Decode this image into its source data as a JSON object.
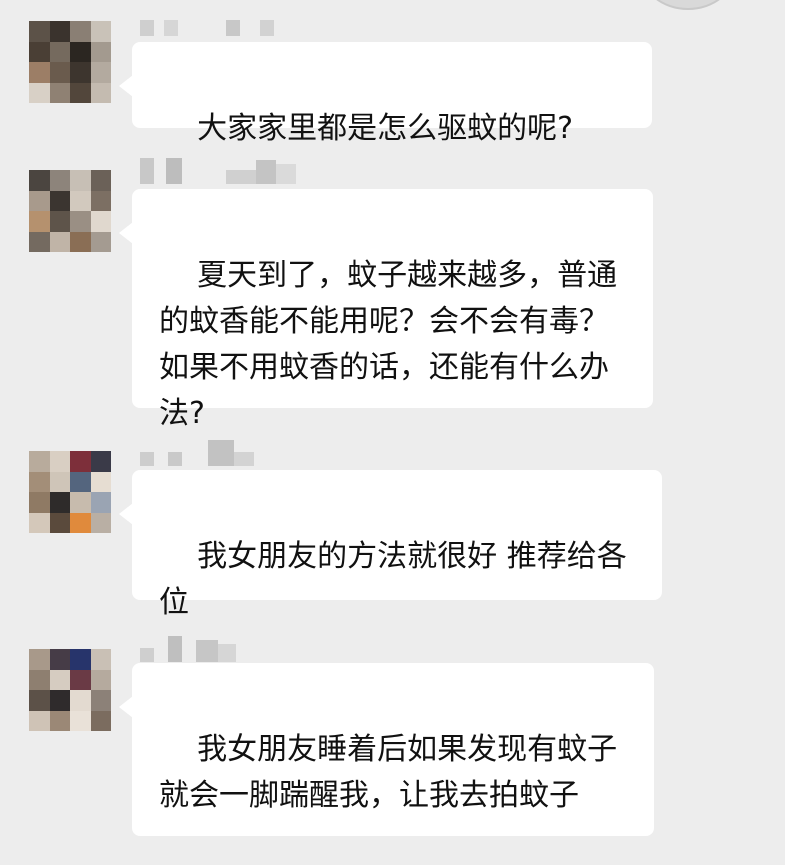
{
  "messages": [
    {
      "sender": "",
      "text": "大家家里都是怎么驱蚊的呢?",
      "avatar_colors": [
        "#5c5248",
        "#3a332d",
        "#8a7f74",
        "#c9c2b8",
        "#4a3f35",
        "#756a5e",
        "#2b2621",
        "#a39a8f",
        "#9c7e66",
        "#6a5b4d",
        "#3d352e",
        "#b3aa9f",
        "#d8d0c6",
        "#8f8173",
        "#52463b",
        "#c4bbb0"
      ]
    },
    {
      "sender": "",
      "text": "夏天到了，蚊子越来越多，普通的蚊香能不能用呢？会不会有毒？如果不用蚊香的话，还能有什么办法?",
      "avatar_colors": [
        "#4b4540",
        "#8d847b",
        "#c7bfb5",
        "#6b6158",
        "#a89a8c",
        "#3b3530",
        "#d2c9be",
        "#7c6f63",
        "#b5916e",
        "#5e544a",
        "#9a8f84",
        "#e0d8ce",
        "#746a60",
        "#c0b4a7",
        "#8a6e55",
        "#a49b91"
      ]
    },
    {
      "sender": "",
      "text": "我女朋友的方法就很好 推荐给各位",
      "avatar_colors": [
        "#b8ab9c",
        "#d9cfc3",
        "#7d2f3a",
        "#3a3a48",
        "#a38e78",
        "#cfc5b8",
        "#54657e",
        "#e6ddd2",
        "#8f7a64",
        "#2e2b2a",
        "#c7bbad",
        "#9aa4b3",
        "#d4c8ba",
        "#5a4a3c",
        "#e08a3c",
        "#b9afa4"
      ]
    },
    {
      "sender": "",
      "text": "我女朋友睡着后如果发现有蚊子就会一脚踹醒我，让我去拍蚊子",
      "avatar_colors": [
        "#a8998a",
        "#463c47",
        "#27346b",
        "#c9c0b5",
        "#8e7f70",
        "#d6ccc1",
        "#6a3a45",
        "#b5aa9e",
        "#5c5148",
        "#2f2b2c",
        "#e3dad0",
        "#8c8178",
        "#cfc3b6",
        "#9b8876",
        "#e9e1d8",
        "#7b6c5f"
      ]
    }
  ]
}
